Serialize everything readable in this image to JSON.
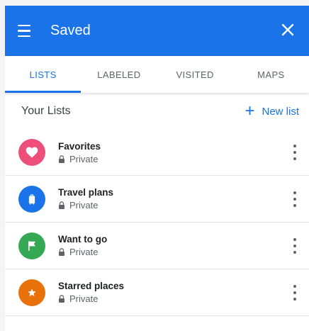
{
  "header": {
    "title": "Saved",
    "menu_icon": "menu-icon",
    "close_icon": "close-icon",
    "color": "#1a73e8"
  },
  "tabs": [
    {
      "label": "LISTS",
      "active": true
    },
    {
      "label": "LABELED",
      "active": false
    },
    {
      "label": "VISITED",
      "active": false
    },
    {
      "label": "MAPS",
      "active": false
    }
  ],
  "section": {
    "title": "Your Lists",
    "new_list_label": "New list"
  },
  "lists": [
    {
      "name": "Favorites",
      "privacy": "Private",
      "icon": "heart-icon",
      "color": "#ee4f7a"
    },
    {
      "name": "Travel plans",
      "privacy": "Private",
      "icon": "suitcase-icon",
      "color": "#1a73e8"
    },
    {
      "name": "Want to go",
      "privacy": "Private",
      "icon": "flag-icon",
      "color": "#34a853"
    },
    {
      "name": "Starred places",
      "privacy": "Private",
      "icon": "star-icon",
      "color": "#e8710a"
    }
  ]
}
